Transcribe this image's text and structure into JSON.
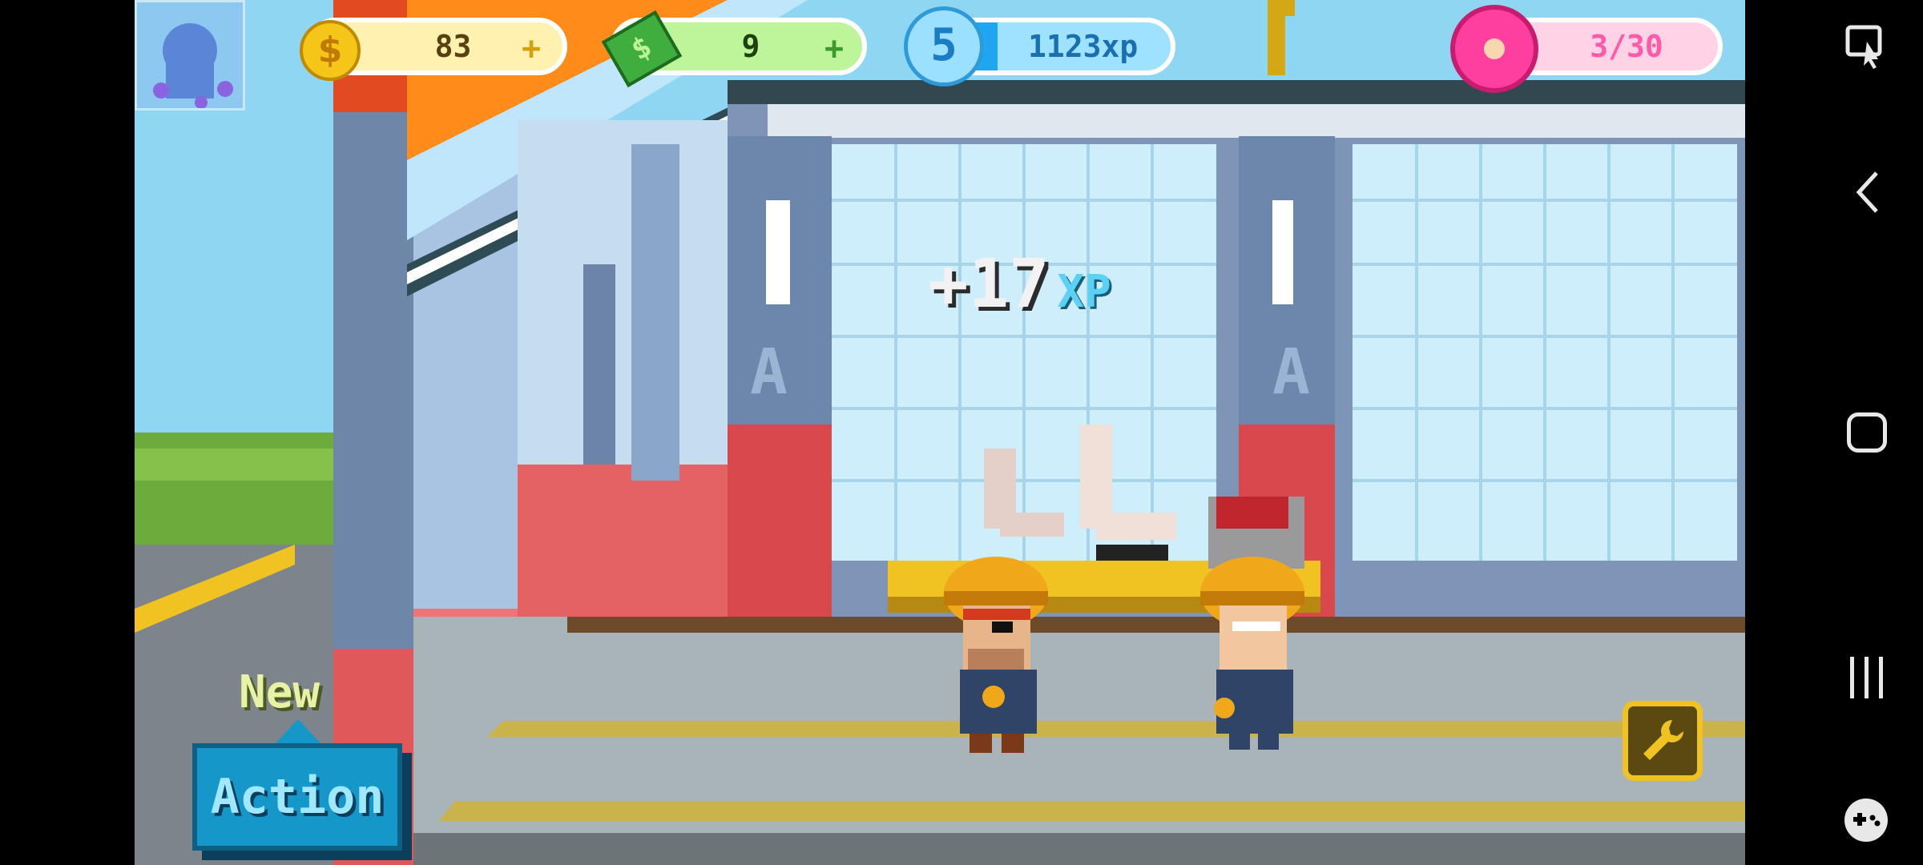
{
  "hud": {
    "coins": "83",
    "cash": "9",
    "level": "5",
    "xp": "1123xp",
    "xp_fill": 0.32,
    "donuts": "3/30",
    "plus": "+"
  },
  "popup": {
    "amount": "+17",
    "unit": "XP"
  },
  "action": {
    "new_label": "New",
    "button_label": "Action"
  },
  "factory": {
    "door_letter_1": "A",
    "door_letter_2": "A"
  },
  "colors": {
    "coin": "#f5c518",
    "cash_bar": "#bff59a",
    "xp_bar": "#9fe2ff",
    "donut": "#ff3fa0",
    "action_button": "#1597c9",
    "new_text": "#e8f2a6"
  },
  "icons": [
    "avatar-icon",
    "coin-icon",
    "cash-icon",
    "level-icon",
    "donut-icon",
    "wrench-icon",
    "screen-mirror-icon",
    "back-icon",
    "home-icon",
    "recents-icon",
    "gamepad-icon"
  ]
}
